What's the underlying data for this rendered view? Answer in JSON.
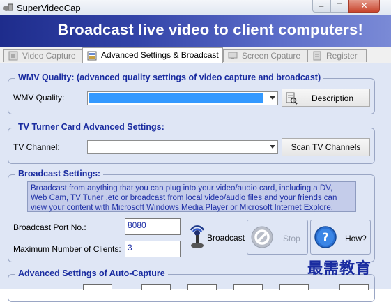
{
  "window": {
    "title": "SuperVideoCap",
    "minimize": "–",
    "maximize": "□",
    "close": "✕"
  },
  "banner": {
    "text": "Broadcast live video to client computers!"
  },
  "tabs": [
    {
      "label": "Video Capture",
      "active": false
    },
    {
      "label": "Advanced Settings & Broadcast",
      "active": true
    },
    {
      "label": "Screen Cpature",
      "active": false
    },
    {
      "label": "Register",
      "active": false
    }
  ],
  "wmv": {
    "title": "WMV Quality: (advanced quality settings of video capture and broadcast)",
    "label": "WMV Quality:",
    "value": "",
    "description_button": "Description"
  },
  "tv": {
    "title": "TV Turner Card Advanced Settings:",
    "label": "TV Channel:",
    "value": "",
    "scan_button": "Scan TV Channels"
  },
  "broadcast": {
    "title": "Broadcast Settings:",
    "info_lines": [
      "Broadcast from anything that you can plug into your video/audio card, including a DV,",
      "Web Cam, TV Tuner ,etc or broadcast from local video/audio files and your friends can",
      "view your content with Microsoft Windows Media Player or Microsoft Internet Explore."
    ],
    "port_label": "Broadcast Port No.:",
    "port_value": "8080",
    "clients_label": "Maximum Number of Clients:",
    "clients_value": "3",
    "broadcast_button": "Broadcast",
    "stop_button": "Stop",
    "how_button": "How?"
  },
  "auto_capture": {
    "title": "Advanced Settings of Auto-Capture"
  },
  "watermark": "最需教育",
  "colors": {
    "banner": "#2a3a9c",
    "panel": "#dfe6f5",
    "group_title": "#1a2ca0",
    "selection": "#3399ff",
    "info_bg": "#c4ccea"
  }
}
